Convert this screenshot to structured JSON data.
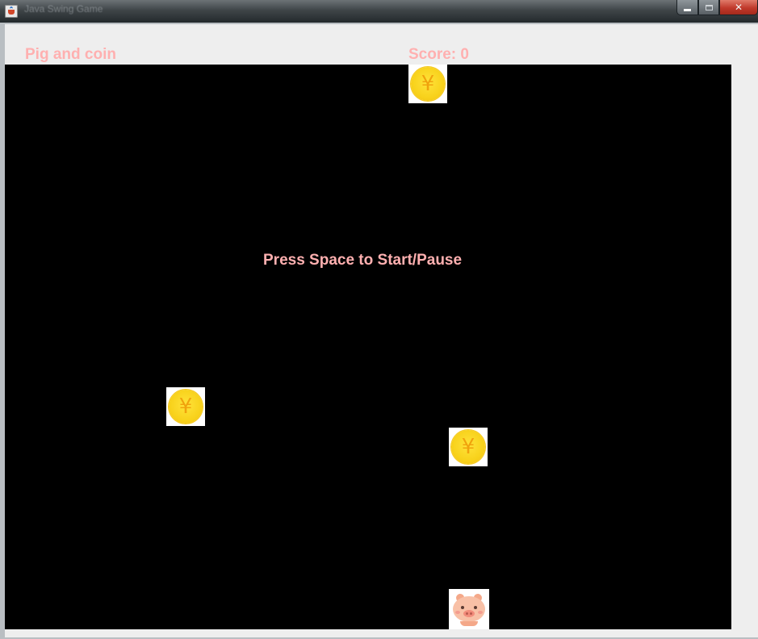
{
  "window": {
    "title": "Java Swing Game",
    "controls": {
      "minimize": "minimize",
      "maximize": "maximize",
      "close": "close"
    }
  },
  "hud": {
    "title": "Pig and coin",
    "score": "Score: 0"
  },
  "board": {
    "message": "Press Space to Start/Pause",
    "background": "#000000"
  },
  "coins": [
    {
      "symbol": "¥"
    },
    {
      "symbol": "¥"
    },
    {
      "symbol": "¥"
    }
  ],
  "colors": {
    "text_accent": "#ffb0b0",
    "coin": "#f8d21c",
    "pig": "#f8c0a6"
  }
}
